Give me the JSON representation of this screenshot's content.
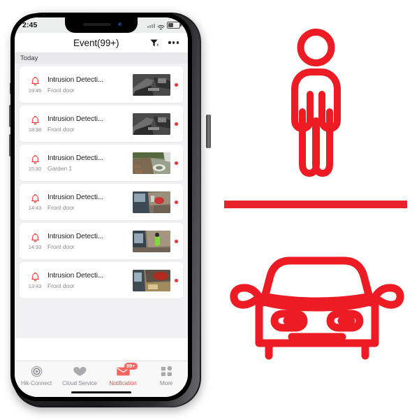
{
  "app": {
    "accent_red": "#ed1c24",
    "active_tab_color": "#f0524e"
  },
  "phone": {
    "status_bar": {
      "time": "2:45",
      "wifi_icon": "wifi-icon",
      "battery_icon": "battery-icon",
      "signal_icon": "signal-icon"
    },
    "header": {
      "title": "Event(99+)",
      "filter_icon": "filter-icon",
      "more_icon": "more-options-icon"
    },
    "list": {
      "day_header": "Today",
      "events": [
        {
          "icon": "bell-icon",
          "time": "19:46",
          "title": "Intrusion Detecti...",
          "channel": "Front door",
          "thumb": "night-driveway",
          "unread": true
        },
        {
          "icon": "bell-icon",
          "time": "18:38",
          "title": "Intrusion Detecti...",
          "channel": "Front door",
          "thumb": "night-driveway",
          "unread": true
        },
        {
          "icon": "bell-icon",
          "time": "15:30",
          "title": "Intrusion Detecti...",
          "channel": "Garden 1",
          "thumb": "garden-day",
          "unread": true
        },
        {
          "icon": "bell-icon",
          "time": "14:43",
          "title": "Intrusion Detecti...",
          "channel": "Front door",
          "thumb": "street-day",
          "unread": true
        },
        {
          "icon": "bell-icon",
          "time": "14:33",
          "title": "Intrusion Detecti...",
          "channel": "Front door",
          "thumb": "person-green",
          "unread": true
        },
        {
          "icon": "bell-icon",
          "time": "13:43",
          "title": "Intrusion Detecti...",
          "channel": "Front door",
          "thumb": "street-car",
          "unread": true
        }
      ]
    },
    "tabbar": {
      "items": [
        {
          "label": "Hik-Connect",
          "icon": "camera-lens-icon",
          "active": false,
          "badge": ""
        },
        {
          "label": "Cloud Service",
          "icon": "cloud-icon",
          "active": false,
          "badge": ""
        },
        {
          "label": "Notification",
          "icon": "envelope-icon",
          "active": true,
          "badge": "99+"
        },
        {
          "label": "More",
          "icon": "grid-more-icon",
          "active": false,
          "badge": ""
        }
      ]
    }
  },
  "graphics": {
    "person": {
      "name": "person-pictogram",
      "color": "#ed1c24"
    },
    "divider": {
      "name": "red-divider-bar",
      "color": "#e8232a"
    },
    "car": {
      "name": "car-front-pictogram",
      "color": "#ed1c24"
    }
  }
}
